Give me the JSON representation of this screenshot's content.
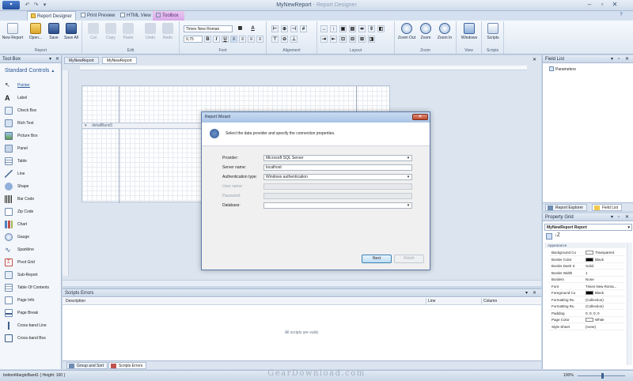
{
  "app": {
    "title": "MyNewReport",
    "subtitle": "Report Designer",
    "app_button": "▾"
  },
  "ribbon_tabs": [
    "Report Designer",
    "Print Preview",
    "HTML View",
    "Toolbox"
  ],
  "ribbon": {
    "groups": {
      "report": "Report",
      "edit": "Edit",
      "font": "Font",
      "alignment": "Alignment",
      "layout": "Layout",
      "zoom": "Zoom",
      "view": "View",
      "scripts": "Scripts"
    },
    "buttons": {
      "new_report": "New Report",
      "open": "Open...",
      "save": "Save",
      "save_all": "Save All",
      "cut": "Cut",
      "copy": "Copy",
      "paste": "Paste",
      "undo": "Undo",
      "redo": "Redo",
      "zoom_out": "Zoom Out",
      "zoom": "Zoom",
      "zoom_in": "Zoom In",
      "windows": "Windows",
      "scripts": "Scripts"
    },
    "font_name": "Times New Roman",
    "font_size": "9,75",
    "bold": "B",
    "italic": "I",
    "underline": "U"
  },
  "toolbox": {
    "title": "Tool Box",
    "section": "Standard Controls",
    "items": [
      "Pointer",
      "Label",
      "Check Box",
      "Rich Text",
      "Picture Box",
      "Panel",
      "Table",
      "Line",
      "Shape",
      "Bar Code",
      "Zip Code",
      "Chart",
      "Gauge",
      "Sparkline",
      "Pivot Grid",
      "Sub-Report",
      "Table Of Contents",
      "Page Info",
      "Page Break",
      "Cross-band Line",
      "Cross-band Box"
    ]
  },
  "document_tabs": [
    "MyNewReport",
    "MyNewReport"
  ],
  "band_label": "detailBand1",
  "scripts_errors": {
    "title": "Scripts Errors",
    "columns": [
      "Description",
      "Line",
      "Column"
    ],
    "message": "All scripts are valid.",
    "tabs": [
      "Group and Sort",
      "Scripts Errors"
    ]
  },
  "field_list": {
    "title": "Field List",
    "node": "Parameters",
    "tabs": [
      "Report Explorer",
      "Field List"
    ]
  },
  "property_grid": {
    "title": "Property Grid",
    "selector": "MyNewReport   Report",
    "category": "Appearance",
    "rows": [
      {
        "name": "Background Co",
        "value": "Transparent",
        "swatch": "#ffffff"
      },
      {
        "name": "Border Color",
        "value": "Black",
        "swatch": "#000000"
      },
      {
        "name": "Border Dash S",
        "value": "Solid",
        "swatch": ""
      },
      {
        "name": "Border Width",
        "value": "1",
        "swatch": ""
      },
      {
        "name": "Borders",
        "value": "None",
        "swatch": ""
      },
      {
        "name": "Font",
        "value": "Times New Roma...",
        "swatch": ""
      },
      {
        "name": "Foreground Co",
        "value": "Black",
        "swatch": "#000000"
      },
      {
        "name": "Formatting Ru",
        "value": "(Collection)",
        "swatch": ""
      },
      {
        "name": "Formatting Ru",
        "value": "(Collection)",
        "swatch": ""
      },
      {
        "name": "Padding",
        "value": "0; 0; 0; 0",
        "swatch": ""
      },
      {
        "name": "Page Color",
        "value": "White",
        "swatch": "#ffffff"
      },
      {
        "name": "Style Sheet",
        "value": "(none)",
        "swatch": ""
      }
    ]
  },
  "status": {
    "left": "bottomMarginBand1 { Height: 100 }",
    "zoom": "100%",
    "watermark": "GearDownload.com"
  },
  "dialog": {
    "title": "Report Wizard",
    "message": "Select the data provider and specify the connection properties.",
    "fields": {
      "provider_label": "Provider:",
      "provider_value": "Microsoft SQL Server",
      "server_label": "Server name:",
      "server_value": "localhost",
      "auth_label": "Authentication type:",
      "auth_value": "Windows authentication",
      "user_label": "User name:",
      "password_label": "Password:",
      "database_label": "Database:",
      "database_value": ""
    },
    "next": "Next",
    "finish": "Finish"
  },
  "colors": {
    "accent": "#2b5797",
    "toolbox_tab": "#d9a9e8"
  }
}
